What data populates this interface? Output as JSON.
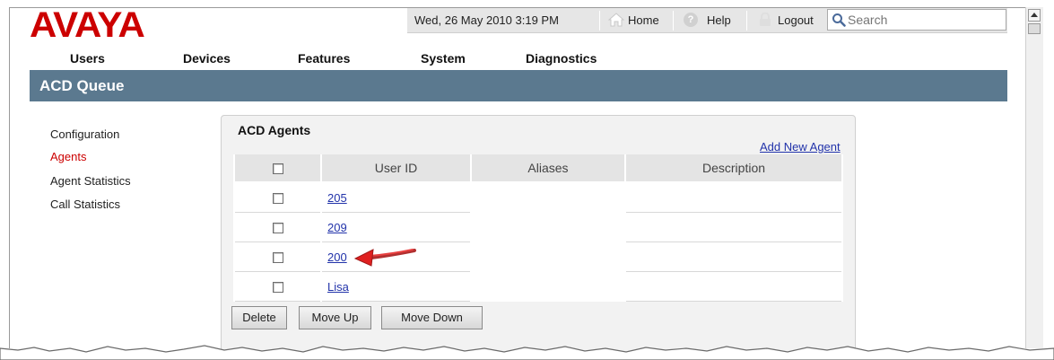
{
  "brand": {
    "logo_text": "AVAYA",
    "logo_color": "#cc0000"
  },
  "utility_bar": {
    "datetime": "Wed, 26 May 2010 3:19 PM",
    "home_label": "Home",
    "help_label": "Help",
    "logout_label": "Logout",
    "search_placeholder": "Search"
  },
  "main_nav": {
    "users": "Users",
    "devices": "Devices",
    "features": "Features",
    "system": "System",
    "diagnostics": "Diagnostics"
  },
  "section": {
    "title": "ACD Queue",
    "header_color": "#5b798f"
  },
  "left_menu": {
    "configuration": "Configuration",
    "agents": "Agents",
    "agent_statistics": "Agent Statistics",
    "call_statistics": "Call Statistics",
    "active_color": "#cc0000"
  },
  "panel": {
    "title": "ACD Agents",
    "add_link": "Add New Agent",
    "columns": {
      "user_id": "User ID",
      "aliases": "Aliases",
      "description": "Description"
    },
    "rows": [
      {
        "user_id": "205",
        "aliases": "",
        "description": ""
      },
      {
        "user_id": "209",
        "aliases": "",
        "description": ""
      },
      {
        "user_id": "200",
        "aliases": "",
        "description": ""
      },
      {
        "user_id": "Lisa",
        "aliases": "",
        "description": ""
      }
    ],
    "buttons": {
      "delete": "Delete",
      "move_up": "Move Up",
      "move_down": "Move Down"
    }
  },
  "icons": [
    "home-icon",
    "help-icon",
    "lock-icon",
    "search-icon",
    "arrow-annotation-icon"
  ]
}
